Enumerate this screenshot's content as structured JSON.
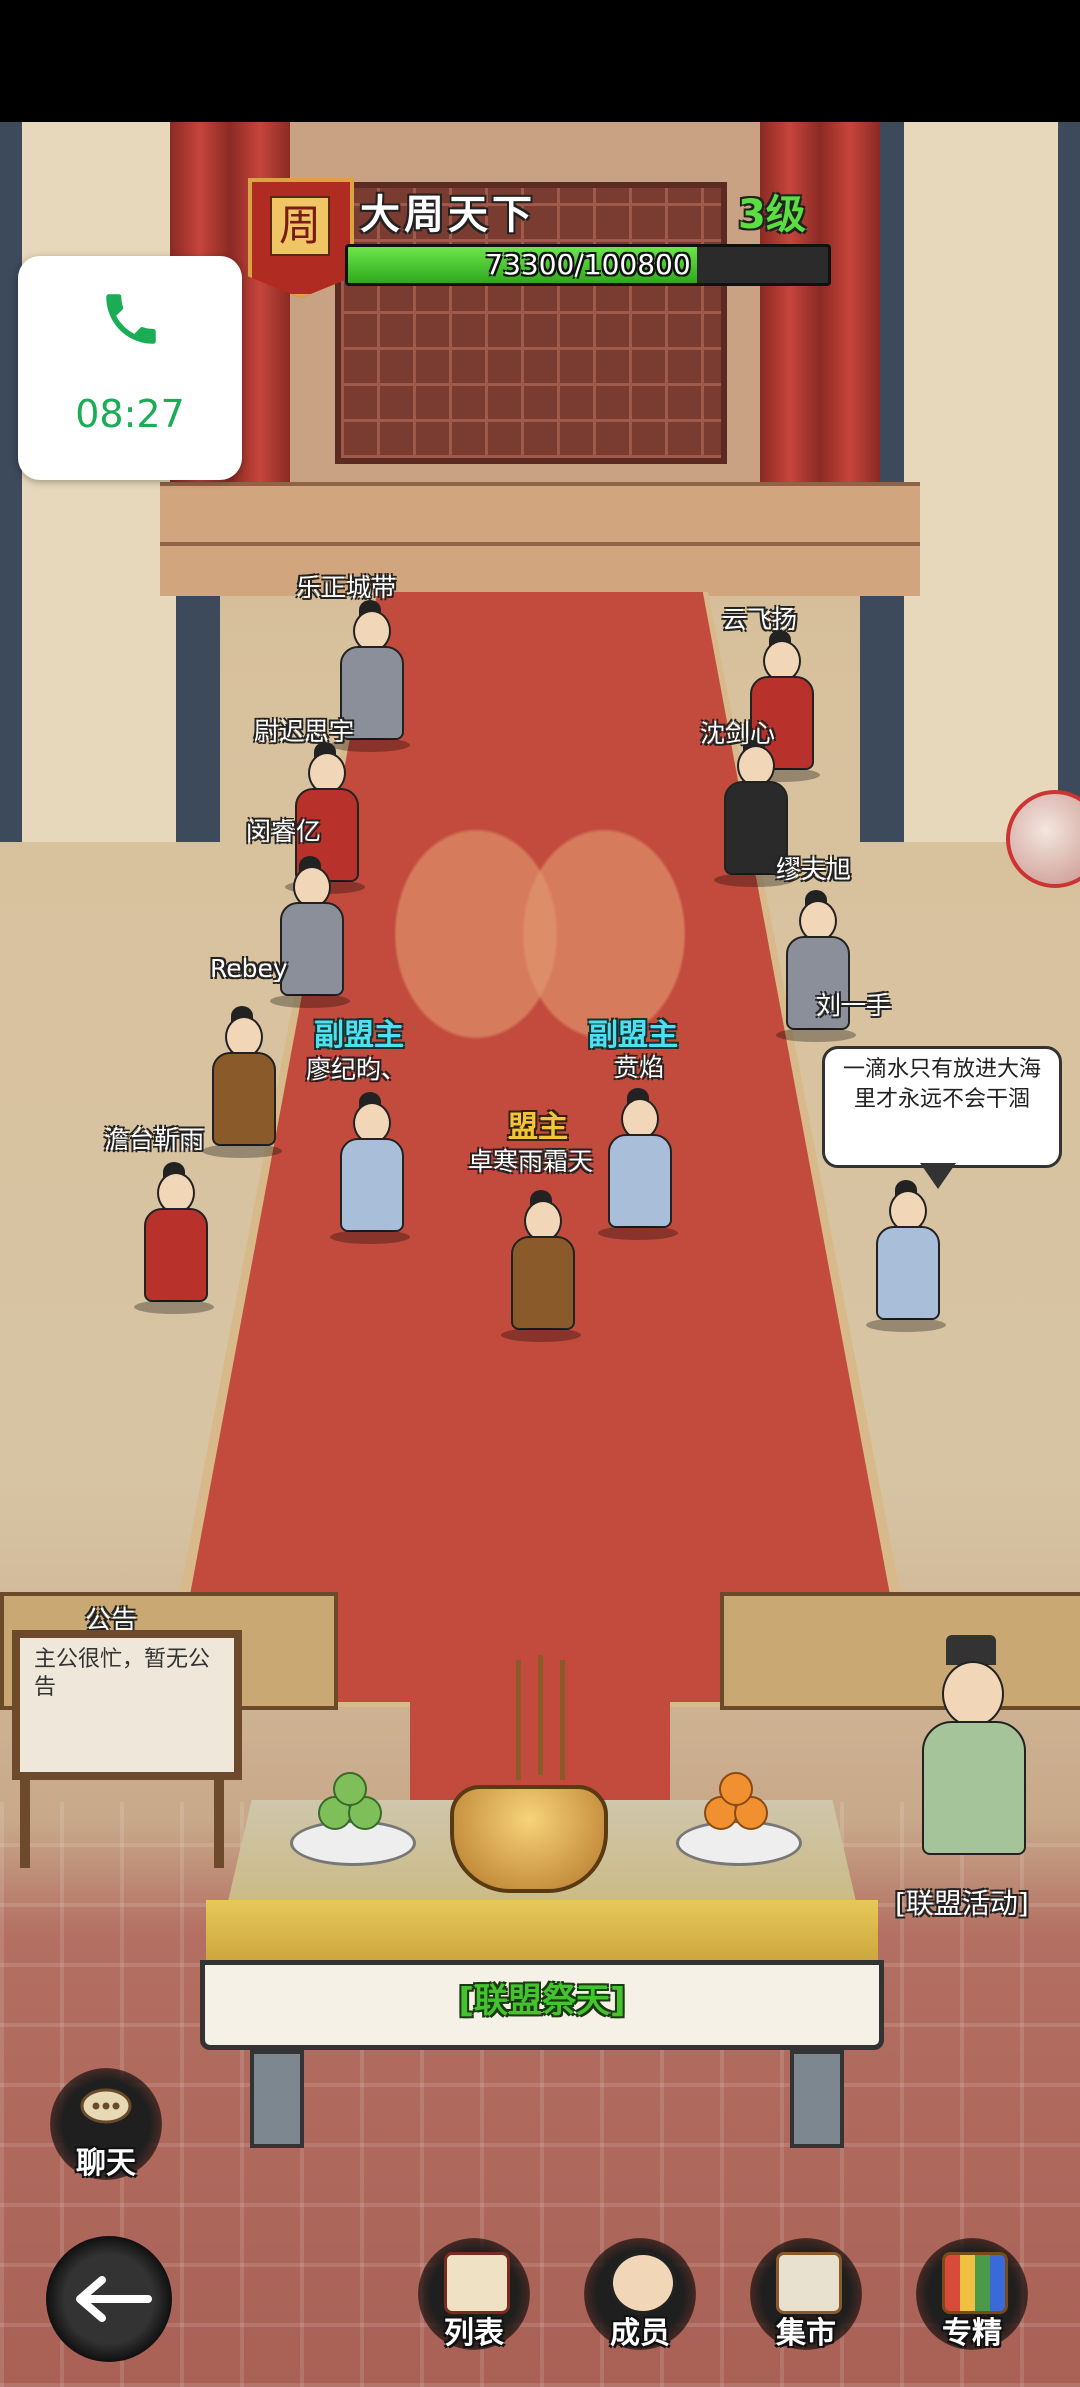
{
  "alliance": {
    "emblem_char": "周",
    "name": "大周天下",
    "level": "3级",
    "exp_text": "73300/100800",
    "exp_fraction": 0.727
  },
  "call_widget": {
    "time": "08:27",
    "icon": "phone-icon"
  },
  "members": {
    "n1": "乐正城带",
    "n2": "云飞扬",
    "n3": "尉迟思宇",
    "n4": "沈剑心",
    "n5": "闵睿亿",
    "n6": "缪夫旭",
    "n7": "Rebey",
    "n8": "刘一手",
    "n9": "澹台靳雨",
    "vice1_role": "副盟主",
    "vice1_name": "廖纪昀、",
    "vice2_role": "副盟主",
    "vice2_name": "贲焰",
    "leader_role": "盟主",
    "leader_name": "卓寒雨霜天"
  },
  "speech_bubble": "一滴水只有放进大海里才永远不会干涸",
  "notice": {
    "title": "公告",
    "text": "主公很忙，暂无公告"
  },
  "altar": {
    "label": "[联盟祭天]"
  },
  "activity": {
    "label": "[联盟活动]"
  },
  "chat": {
    "label": "聊天",
    "icon": "chat-bubble-icon"
  },
  "nav": {
    "back_icon": "back-arrow-icon",
    "buttons": [
      {
        "label": "列表",
        "icon": "list-scroll-icon"
      },
      {
        "label": "成员",
        "icon": "members-icon"
      },
      {
        "label": "集市",
        "icon": "market-icon"
      },
      {
        "label": "专精",
        "icon": "specialty-board-icon"
      }
    ]
  }
}
